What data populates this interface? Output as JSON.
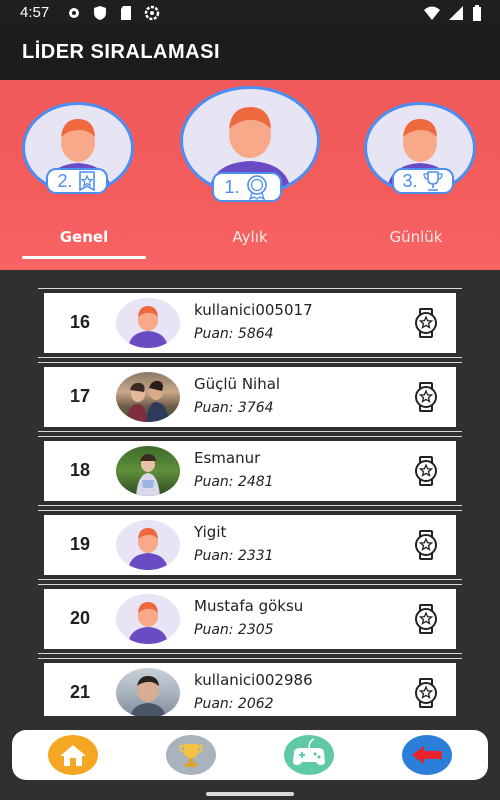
{
  "status_bar": {
    "time": "4:57"
  },
  "app_bar": {
    "title": "LİDER SIRALAMASI"
  },
  "podium": [
    {
      "rank_label": "2."
    },
    {
      "rank_label": "1."
    },
    {
      "rank_label": "3."
    }
  ],
  "tabs": [
    {
      "label": "Genel",
      "active": true
    },
    {
      "label": "Aylık",
      "active": false
    },
    {
      "label": "Günlük",
      "active": false
    }
  ],
  "leaderboard": [
    {
      "rank": "16",
      "name": "kullanici005017",
      "score": "Puan: 5864",
      "avatar": "default"
    },
    {
      "rank": "17",
      "name": "Güçlü Nihal",
      "score": "Puan: 3764",
      "avatar": "photo"
    },
    {
      "rank": "18",
      "name": "Esmanur",
      "score": "Puan: 2481",
      "avatar": "photo"
    },
    {
      "rank": "19",
      "name": "Yigit",
      "score": "Puan: 2331",
      "avatar": "default"
    },
    {
      "rank": "20",
      "name": "Mustafa göksu",
      "score": "Puan: 2305",
      "avatar": "default"
    },
    {
      "rank": "21",
      "name": "kullanici002986",
      "score": "Puan: 2062",
      "avatar": "photo"
    }
  ],
  "bottom_nav": [
    {
      "icon": "home-icon",
      "color": "#f5a623"
    },
    {
      "icon": "trophy-icon",
      "color": "#a9b2bd"
    },
    {
      "icon": "gamepad-icon",
      "color": "#5fc9a8"
    },
    {
      "icon": "back-arrow-icon",
      "color": "#2b7fd8"
    }
  ],
  "colors": {
    "header": "#f45c5c",
    "accent_blue": "#4c8ef0",
    "background": "#303030"
  }
}
